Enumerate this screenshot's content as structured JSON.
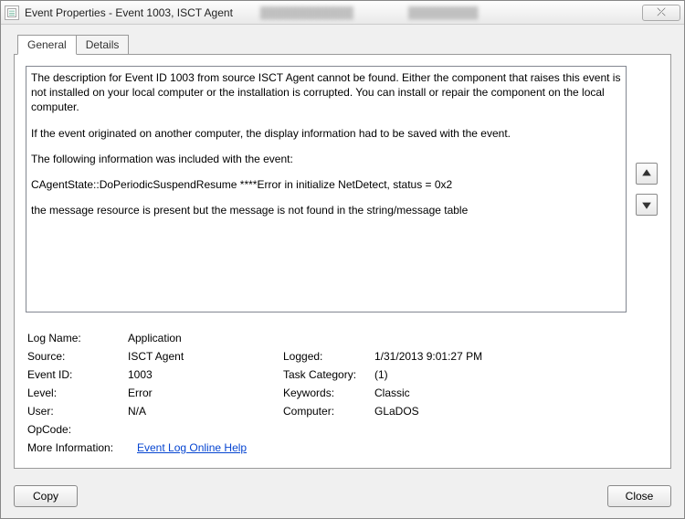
{
  "window": {
    "title": "Event Properties - Event 1003, ISCT Agent",
    "close_glyph": "⤫"
  },
  "tabs": {
    "general": "General",
    "details": "Details"
  },
  "description": {
    "p1": "The description for Event ID 1003 from source ISCT Agent cannot be found. Either the component that raises this event is not installed on your local computer or the installation is corrupted. You can install or repair the component on the local computer.",
    "p2": "If the event originated on another computer, the display information had to be saved with the event.",
    "p3": "The following information was included with the event:",
    "p4": "CAgentState::DoPeriodicSuspendResume     ****Error in initialize NetDetect, status = 0x2",
    "p5": "the message resource is present but the message is not found in the string/message table"
  },
  "fields": {
    "logname_lbl": "Log Name:",
    "logname_val": "Application",
    "source_lbl": "Source:",
    "source_val": "ISCT Agent",
    "logged_lbl": "Logged:",
    "logged_val": "1/31/2013 9:01:27 PM",
    "eventid_lbl": "Event ID:",
    "eventid_val": "1003",
    "taskcat_lbl": "Task Category:",
    "taskcat_val": "(1)",
    "level_lbl": "Level:",
    "level_val": "Error",
    "keywords_lbl": "Keywords:",
    "keywords_val": "Classic",
    "user_lbl": "User:",
    "user_val": "N/A",
    "computer_lbl": "Computer:",
    "computer_val": "GLaDOS",
    "opcode_lbl": "OpCode:",
    "opcode_val": "",
    "moreinfo_lbl": "More Information:",
    "moreinfo_link": "Event Log Online Help"
  },
  "buttons": {
    "copy": "Copy",
    "close": "Close"
  }
}
